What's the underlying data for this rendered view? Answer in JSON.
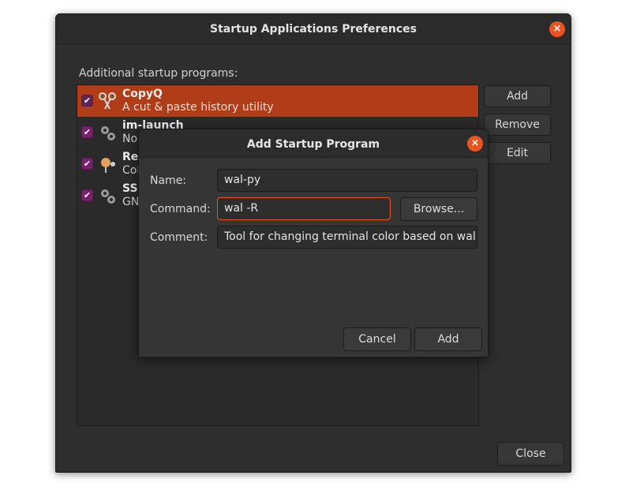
{
  "main_window": {
    "title": "Startup Applications Preferences",
    "section_label": "Additional startup programs:",
    "buttons": {
      "add": "Add",
      "remove": "Remove",
      "edit": "Edit",
      "close": "Close"
    },
    "close_glyph": "×",
    "programs": [
      {
        "name": "CopyQ",
        "description": "A cut & paste history utility",
        "checked": true,
        "selected": true,
        "icon": "scissors-icon"
      },
      {
        "name": "im-launch",
        "description": "No",
        "checked": true,
        "selected": false,
        "icon": "gears-icon"
      },
      {
        "name": "Re",
        "description": "Col",
        "checked": true,
        "selected": false,
        "icon": "redshift-icon"
      },
      {
        "name": "SSI",
        "description": "GN",
        "checked": true,
        "selected": false,
        "icon": "gears-icon"
      }
    ]
  },
  "dialog": {
    "title": "Add Startup Program",
    "close_glyph": "×",
    "labels": {
      "name": "Name:",
      "command": "Command:",
      "comment": "Comment:"
    },
    "values": {
      "name": "wal-py",
      "command": "wal -R",
      "comment": "Tool for changing terminal color based on wallp"
    },
    "buttons": {
      "browse": "Browse...",
      "cancel": "Cancel",
      "add": "Add"
    }
  },
  "colors": {
    "accent": "#e95420",
    "selection": "#b03d17",
    "checkbox": "#77216f"
  },
  "check_glyph": "✔"
}
